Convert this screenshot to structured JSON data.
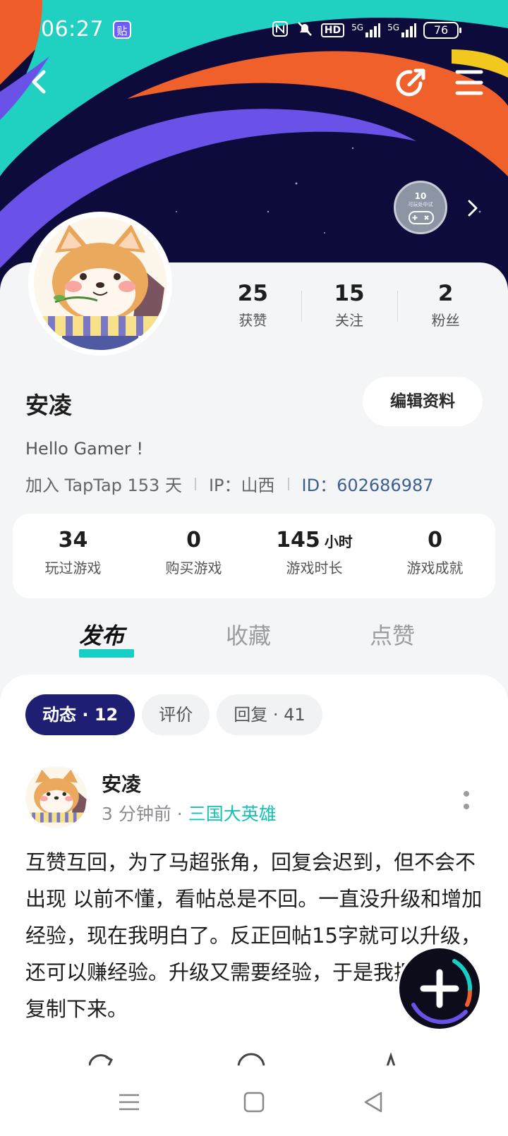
{
  "status_bar": {
    "time": "06:27",
    "app_badge": "贴",
    "icons": [
      "nfc-icon",
      "mute-icon",
      "hd-icon",
      "5g-signal-icon",
      "5g-signal-icon"
    ],
    "hd_label": "HD",
    "sig1": "5G",
    "sig2": "5G",
    "battery": "76"
  },
  "top_nav": {
    "back_icon": "chevron-left-icon",
    "share_icon": "share-icon",
    "menu_icon": "menu-icon"
  },
  "badge": {
    "level": "10",
    "subtitle": "可玩处中试"
  },
  "profile": {
    "stats": [
      {
        "value": "25",
        "label": "获赞"
      },
      {
        "value": "15",
        "label": "关注"
      },
      {
        "value": "2",
        "label": "粉丝"
      }
    ],
    "name": "安凌",
    "edit_label": "编辑资料",
    "bio": "Hello Gamer !",
    "joined": "加入 TapTap 153 天",
    "ip": "IP：山西",
    "id": "ID：602686987"
  },
  "game_stats": [
    {
      "value": "34",
      "unit": "",
      "label": "玩过游戏"
    },
    {
      "value": "0",
      "unit": "",
      "label": "购买游戏"
    },
    {
      "value": "145",
      "unit": "小时",
      "label": "游戏时长"
    },
    {
      "value": "0",
      "unit": "",
      "label": "游戏成就"
    }
  ],
  "tabs": [
    "发布",
    "收藏",
    "点赞"
  ],
  "chips": [
    "动态 · 12",
    "评价",
    "回复 · 41"
  ],
  "post": {
    "author": "安凌",
    "time": "3 分钟前",
    "dot": " · ",
    "game": "三国大英雄",
    "text": "互赞互回，为了马超张角，回复会迟到，但不会不出现 以前不懂，看帖总是不回。一直没升级和增加经验，现在我明白了。反正回帖15字就可以升级，还可以赚经验。升级又需要经验，于是我把这句话复制下来。"
  },
  "colors": {
    "banner_bg": "#0c0b3c",
    "accent_teal": "#17cfc4",
    "chip_active": "#1e1f72",
    "id_blue": "#3c5f92"
  }
}
